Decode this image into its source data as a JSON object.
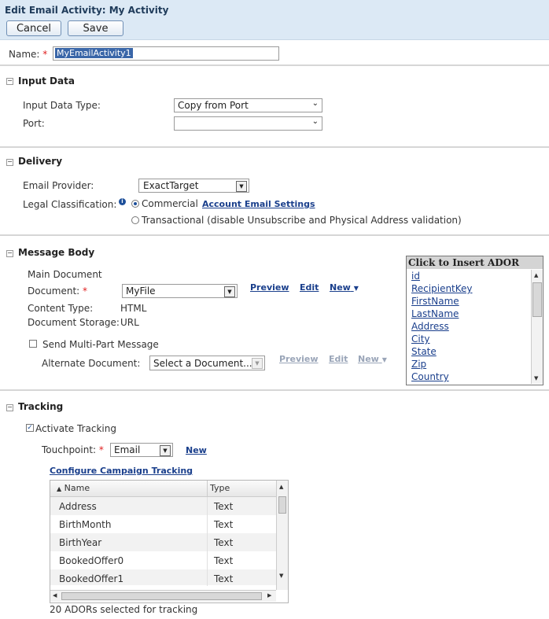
{
  "header": {
    "title": "Edit Email Activity: My Activity",
    "cancel_label": "Cancel",
    "save_label": "Save"
  },
  "name_field": {
    "label": "Name:",
    "required_mark": "*",
    "value": "MyEmailActivity1"
  },
  "input_data": {
    "section_title": "Input Data",
    "type_label": "Input Data Type:",
    "type_value": "Copy from Port",
    "port_label": "Port:",
    "port_value": ""
  },
  "delivery": {
    "section_title": "Delivery",
    "provider_label": "Email Provider:",
    "provider_value": "ExactTarget",
    "legal_label": "Legal Classification:",
    "commercial_label": "Commercial",
    "account_link": "Account Email Settings",
    "transactional_label": "Transactional (disable Unsubscribe and Physical Address validation)",
    "selected": "Commercial"
  },
  "message_body": {
    "section_title": "Message Body",
    "main_doc_label": "Main Document",
    "document_label": "Document:",
    "document_value": "MyFile",
    "preview_link": "Preview",
    "edit_link": "Edit",
    "new_link": "New",
    "content_type_label": "Content Type:",
    "content_type_value": "HTML",
    "storage_label": "Document Storage:",
    "storage_value": "URL",
    "multipart_label": "Send Multi-Part Message",
    "multipart_checked": false,
    "alt_doc_label": "Alternate Document:",
    "alt_doc_value": "Select a Document...",
    "alt_preview_link": "Preview",
    "alt_edit_link": "Edit",
    "alt_new_link": "New"
  },
  "ador_panel": {
    "title": "Click to Insert ADOR",
    "items": [
      "id",
      "RecipientKey",
      "FirstName",
      "LastName",
      "Address",
      "City",
      "State",
      "Zip",
      "Country"
    ]
  },
  "tracking": {
    "section_title": "Tracking",
    "activate_label": "Activate Tracking",
    "activate_checked": true,
    "touchpoint_label": "Touchpoint:",
    "touchpoint_value": "Email",
    "new_link": "New",
    "configure_link": "Configure Campaign Tracking",
    "grid": {
      "columns": [
        "Name",
        "Type"
      ],
      "rows": [
        [
          "Address",
          "Text"
        ],
        [
          "BirthMonth",
          "Text"
        ],
        [
          "BirthYear",
          "Text"
        ],
        [
          "BookedOffer0",
          "Text"
        ],
        [
          "BookedOffer1",
          "Text"
        ]
      ]
    },
    "summary": "20 ADORs selected for tracking"
  },
  "icons": {
    "collapse": "minus-icon",
    "dropdown": "chevron-down-icon",
    "info": "info-icon",
    "sort": "sort-up-icon"
  },
  "colors": {
    "header_bg": "#dce9f5",
    "link": "#1a3f8c",
    "required": "#e02020"
  }
}
